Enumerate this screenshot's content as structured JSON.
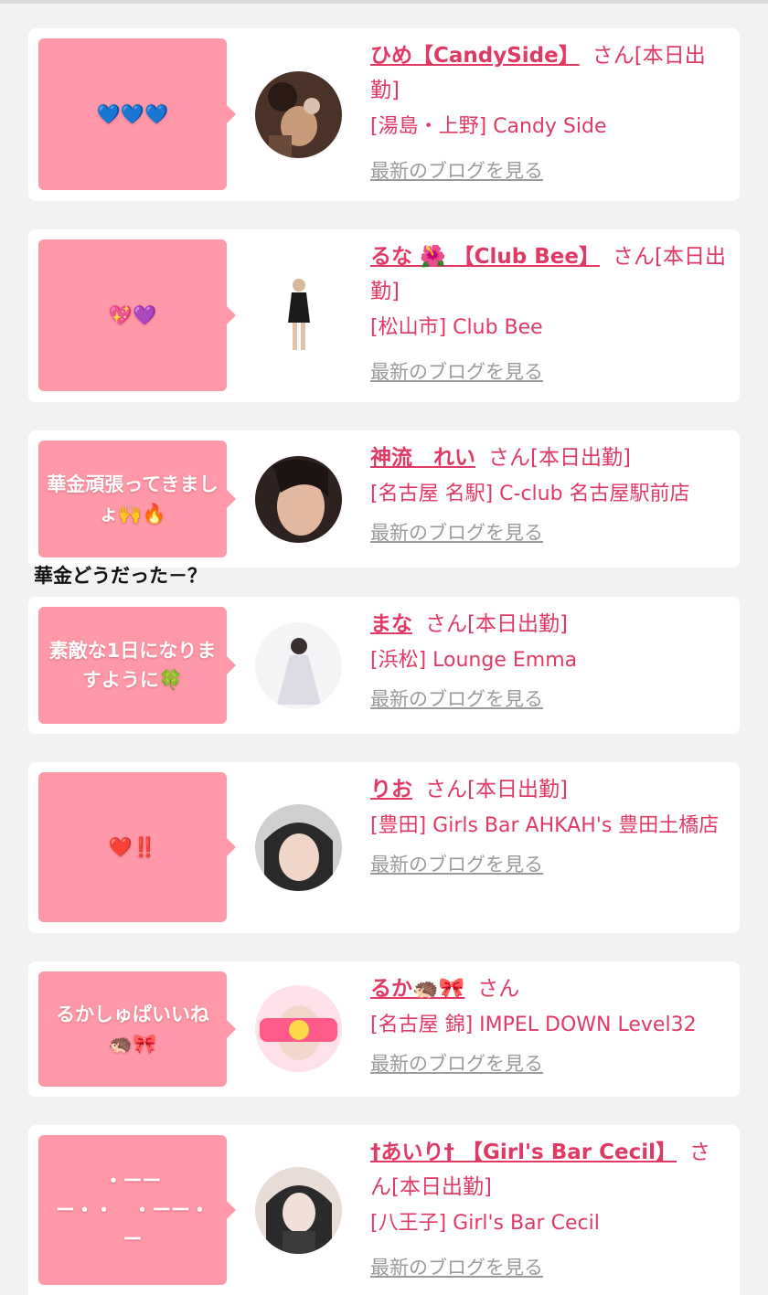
{
  "caption": "華金どうだった－？",
  "blog_label": "最新のブログを見る",
  "cards": [
    {
      "bubble": "💙💙💙",
      "name": "ひめ【CandySide】",
      "status": "さん[本日出勤]",
      "shop": "[湯島・上野] Candy Side",
      "avatar_colors": [
        "#5a3a2e",
        "#c79a7a"
      ]
    },
    {
      "bubble": "💖💜",
      "name": "るな 🌺 【Club Bee】",
      "status": "さん[本日出勤]",
      "shop": "[松山市] Club Bee",
      "avatar_colors": [
        "#ffffff",
        "#1b1b1b"
      ]
    },
    {
      "bubble": "華金頑張ってきましょ🙌🔥",
      "name": "神流　れい",
      "status": "さん[本日出勤]",
      "shop": "[名古屋 名駅] C-club 名古屋駅前店",
      "avatar_colors": [
        "#3a2b28",
        "#e3b8a0"
      ]
    },
    {
      "bubble": "素敵な1日になりますように🍀",
      "name": "まな",
      "status": "さん[本日出勤]",
      "shop": "[浜松] Lounge Emma",
      "avatar_colors": [
        "#f4f4f6",
        "#d9d9e0"
      ]
    },
    {
      "bubble": "❤️‼️",
      "name": "りお",
      "status": "さん[本日出勤]",
      "shop": "[豊田] Girls Bar AHKAH's 豊田土橋店",
      "avatar_colors": [
        "#cfcfcf",
        "#2a2a2a"
      ]
    },
    {
      "bubble": "るかしゅぱいいね🦔🎀",
      "name": "るか🦔🎀",
      "status": "さん",
      "shop": "[名古屋 錦] IMPEL DOWN Level32",
      "avatar_colors": [
        "#ff5a8a",
        "#ffe1ea"
      ]
    },
    {
      "bubble": "・ーー\nー・・　・ーー・\nー",
      "name": "†あいり† 【Girl's Bar Cecil】",
      "status": "さん[本日出勤]",
      "shop": "[八王子] Girl's Bar Cecil",
      "avatar_colors": [
        "#2b2b2b",
        "#e8dcd6"
      ]
    }
  ]
}
